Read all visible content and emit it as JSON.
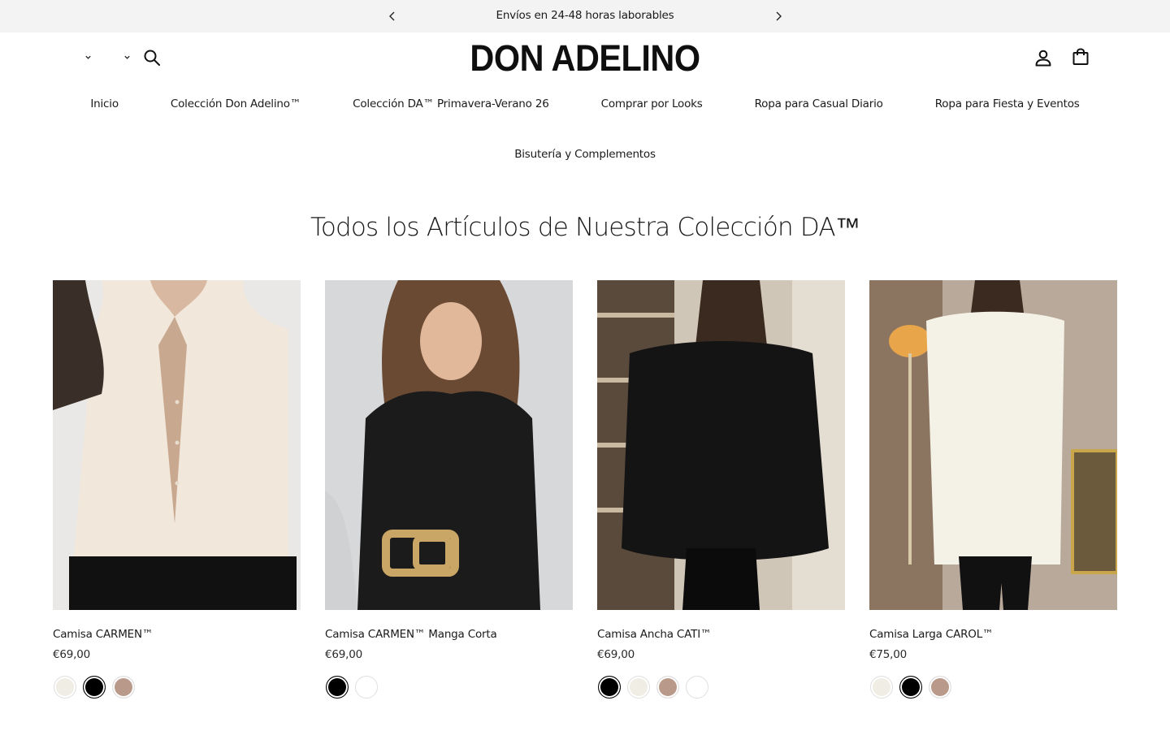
{
  "announcement": {
    "text": "Envíos en 24-48 horas laborables"
  },
  "brand": {
    "name": "DON ADELINO"
  },
  "nav": {
    "row1": [
      "Inicio",
      "Colección Don Adelino™",
      "Colección DA™ Primavera-Verano 26",
      "Comprar por Looks",
      "Ropa para Casual Diario",
      "Ropa para Fiesta y Eventos"
    ],
    "row2": [
      "Bisutería y Complementos"
    ]
  },
  "section": {
    "title": "Todos los Artículos de Nuestra Colección DA™"
  },
  "products": [
    {
      "title": "Camisa CARMEN™",
      "price": "€69,00",
      "swatches": [
        "#f0ede4",
        "#000000",
        "#b9998a"
      ]
    },
    {
      "title": "Camisa CARMEN™ Manga Corta",
      "price": "€69,00",
      "swatches": [
        "#000000",
        "#ffffff"
      ]
    },
    {
      "title": "Camisa Ancha CATI™",
      "price": "€69,00",
      "swatches": [
        "#000000",
        "#f0ede4",
        "#b9998a",
        "#ffffff"
      ]
    },
    {
      "title": "Camisa Larga CAROL™",
      "price": "€75,00",
      "swatches": [
        "#f0ede4",
        "#000000",
        "#b9998a"
      ]
    }
  ],
  "icons": {
    "prev": "chevron-left-icon",
    "next": "chevron-right-icon",
    "search": "search-icon",
    "account": "user-icon",
    "cart": "shopping-bag-icon"
  },
  "colors": {
    "announcement_bg": "#f3f3f3",
    "text": "#1a1a1a"
  }
}
